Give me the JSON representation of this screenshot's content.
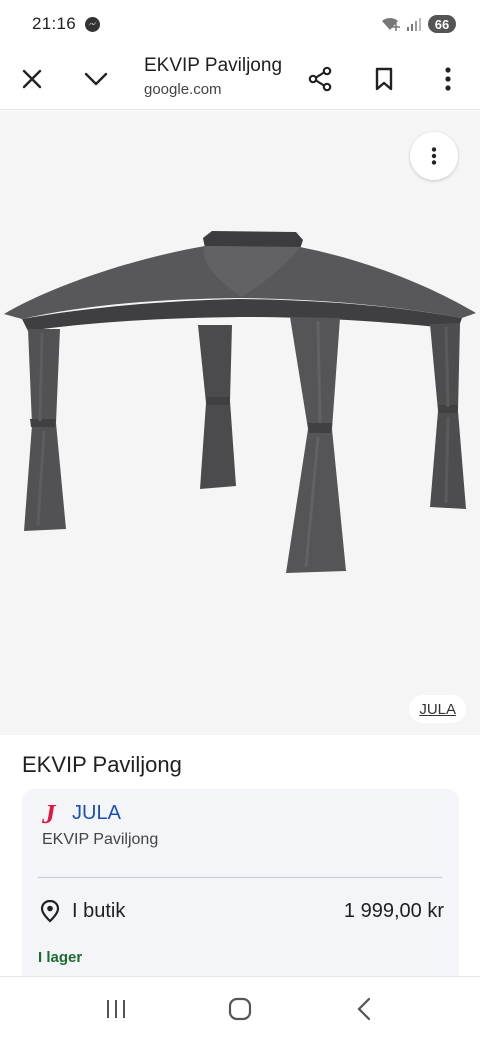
{
  "status": {
    "time": "21:16",
    "battery": "66"
  },
  "toolbar": {
    "title": "EKVIP Paviljong",
    "host": "google.com"
  },
  "image": {
    "source_label": "JULA"
  },
  "product": {
    "title": "EKVIP Paviljong"
  },
  "offer": {
    "seller": "JULA",
    "seller_logo": "J",
    "product_name": "EKVIP Paviljong",
    "store_label": "I butik",
    "price": "1 999,00 kr",
    "stock": "I lager"
  },
  "colors": {
    "brand_red": "#e0173e",
    "link_blue": "#1a50b8",
    "stock_green": "#1e6b2e",
    "canopy_gray": "#4f4f51"
  },
  "icons": {
    "close": "close-icon",
    "collapse": "chevron-down-icon",
    "share": "share-icon",
    "bookmark": "bookmark-icon",
    "menu": "more-vert-icon",
    "location": "location-pin-icon"
  }
}
